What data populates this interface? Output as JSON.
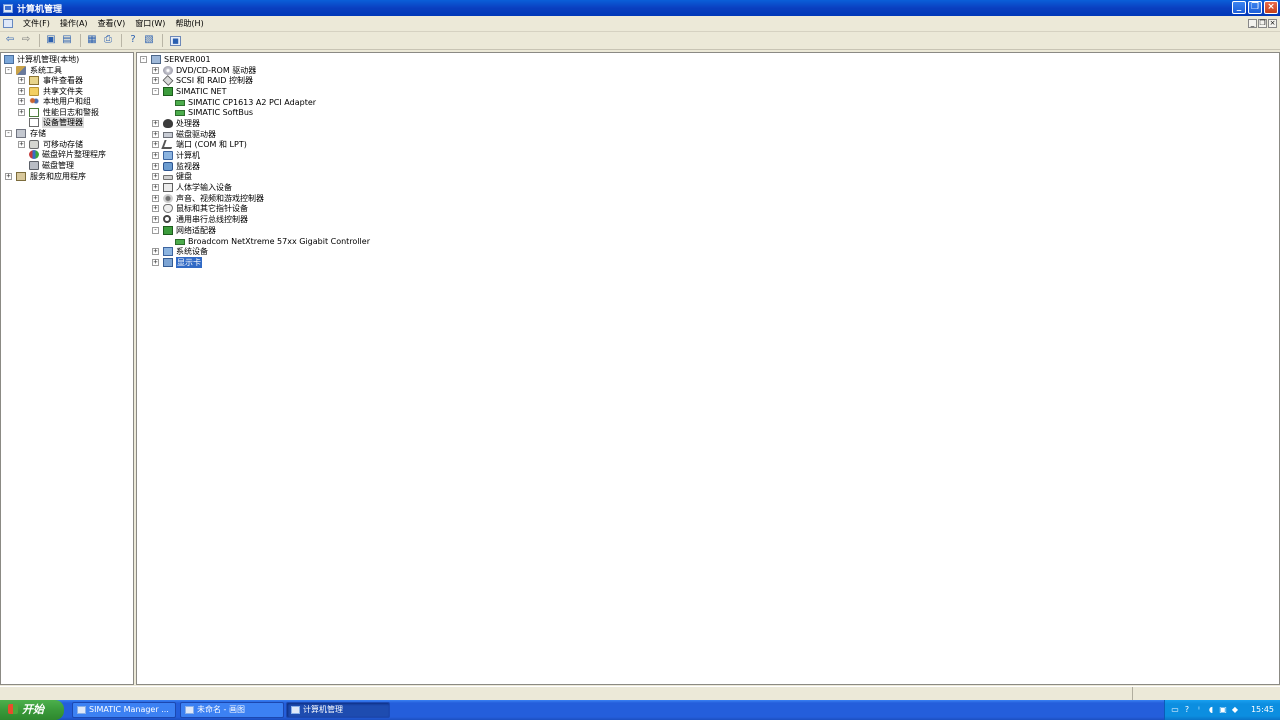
{
  "window": {
    "title": "计算机管理"
  },
  "menubar": {
    "items": [
      "文件(F)",
      "操作(A)",
      "查看(V)",
      "窗口(W)",
      "帮助(H)"
    ]
  },
  "left_tree": {
    "items": [
      {
        "label": "计算机管理(本地)",
        "icon": "computer-management-icon"
      },
      {
        "label": "系统工具",
        "icon": "system-tools-icon"
      },
      {
        "label": "事件查看器",
        "icon": "event-viewer-icon"
      },
      {
        "label": "共享文件夹",
        "icon": "shared-folder-icon"
      },
      {
        "label": "本地用户和组",
        "icon": "users-icon"
      },
      {
        "label": "性能日志和警报",
        "icon": "performance-icon"
      },
      {
        "label": "设备管理器",
        "icon": "device-manager-icon"
      },
      {
        "label": "存储",
        "icon": "storage-icon"
      },
      {
        "label": "可移动存储",
        "icon": "removable-storage-icon"
      },
      {
        "label": "磁盘碎片整理程序",
        "icon": "defrag-icon"
      },
      {
        "label": "磁盘管理",
        "icon": "disk-management-icon"
      },
      {
        "label": "服务和应用程序",
        "icon": "services-icon"
      }
    ]
  },
  "device_tree": {
    "root": "SERVER001",
    "items": [
      {
        "label": "DVD/CD-ROM 驱动器",
        "icon": "cdrom-icon"
      },
      {
        "label": "SCSI 和 RAID 控制器",
        "icon": "scsi-icon"
      },
      {
        "label": "SIMATIC NET",
        "icon": "network-icon"
      },
      {
        "label": "SIMATIC CP1613 A2 PCI Adapter",
        "icon": "network-card-icon"
      },
      {
        "label": "SIMATIC SoftBus",
        "icon": "network-card-icon"
      },
      {
        "label": "处理器",
        "icon": "processor-icon"
      },
      {
        "label": "磁盘驱动器",
        "icon": "disk-drive-icon"
      },
      {
        "label": "端口 (COM 和 LPT)",
        "icon": "port-icon"
      },
      {
        "label": "计算机",
        "icon": "computer-icon"
      },
      {
        "label": "监视器",
        "icon": "monitor-icon"
      },
      {
        "label": "键盘",
        "icon": "keyboard-icon"
      },
      {
        "label": "人体学输入设备",
        "icon": "hid-icon"
      },
      {
        "label": "声音、视频和游戏控制器",
        "icon": "sound-icon"
      },
      {
        "label": "鼠标和其它指针设备",
        "icon": "mouse-icon"
      },
      {
        "label": "通用串行总线控制器",
        "icon": "usb-icon"
      },
      {
        "label": "网络适配器",
        "icon": "network-icon"
      },
      {
        "label": "Broadcom NetXtreme 57xx Gigabit Controller",
        "icon": "network-card-icon"
      },
      {
        "label": "系统设备",
        "icon": "system-device-icon"
      },
      {
        "label": "显示卡",
        "icon": "display-adapter-icon"
      }
    ]
  },
  "taskbar": {
    "start_label": "开始",
    "tasks": [
      "SIMATIC Manager ...",
      "未命名 - 画图",
      "计算机管理"
    ],
    "clock": "15:45"
  }
}
